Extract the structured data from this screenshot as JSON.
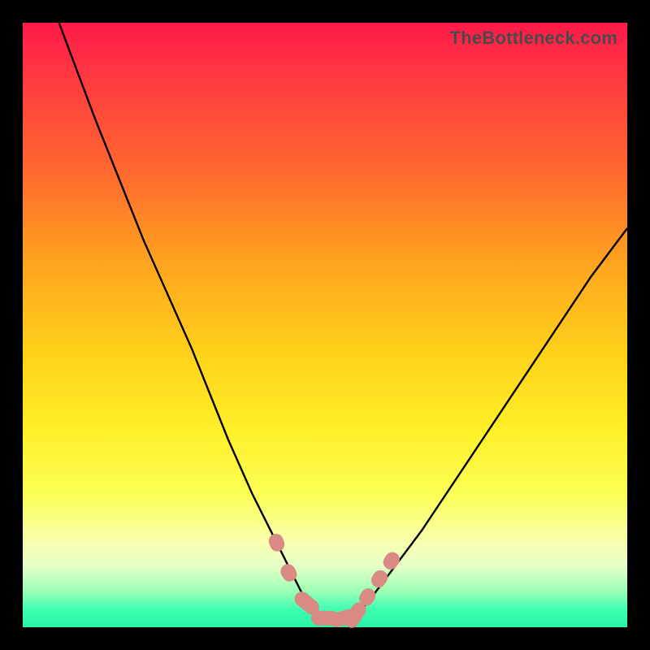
{
  "watermark": "TheBottleneck.com",
  "chart_data": {
    "type": "line",
    "title": "",
    "xlabel": "",
    "ylabel": "",
    "xlim": [
      0,
      100
    ],
    "ylim": [
      0,
      100
    ],
    "series": [
      {
        "name": "bottleneck-curve",
        "x": [
          6,
          12,
          20,
          28,
          34,
          38,
          42,
          45,
          47,
          49,
          51,
          53,
          55,
          57,
          60,
          66,
          74,
          84,
          94,
          100
        ],
        "values": [
          100,
          84,
          64,
          46,
          31,
          22,
          14,
          8,
          4,
          2,
          1,
          1,
          2,
          4,
          8,
          16,
          28,
          43,
          58,
          66
        ]
      }
    ],
    "markers": {
      "name": "highlight-segments",
      "color": "#d98a82",
      "points": [
        {
          "x": 42,
          "y": 14
        },
        {
          "x": 44,
          "y": 9
        },
        {
          "x": 47,
          "y": 4
        },
        {
          "x": 50,
          "y": 1.5
        },
        {
          "x": 53,
          "y": 1.5
        },
        {
          "x": 55,
          "y": 2
        },
        {
          "x": 57,
          "y": 5
        },
        {
          "x": 59,
          "y": 8
        },
        {
          "x": 61,
          "y": 11
        }
      ]
    },
    "background_gradient": {
      "top": "#ff1a4a",
      "mid": "#ffd21a",
      "bottom": "#27f3a6"
    }
  }
}
